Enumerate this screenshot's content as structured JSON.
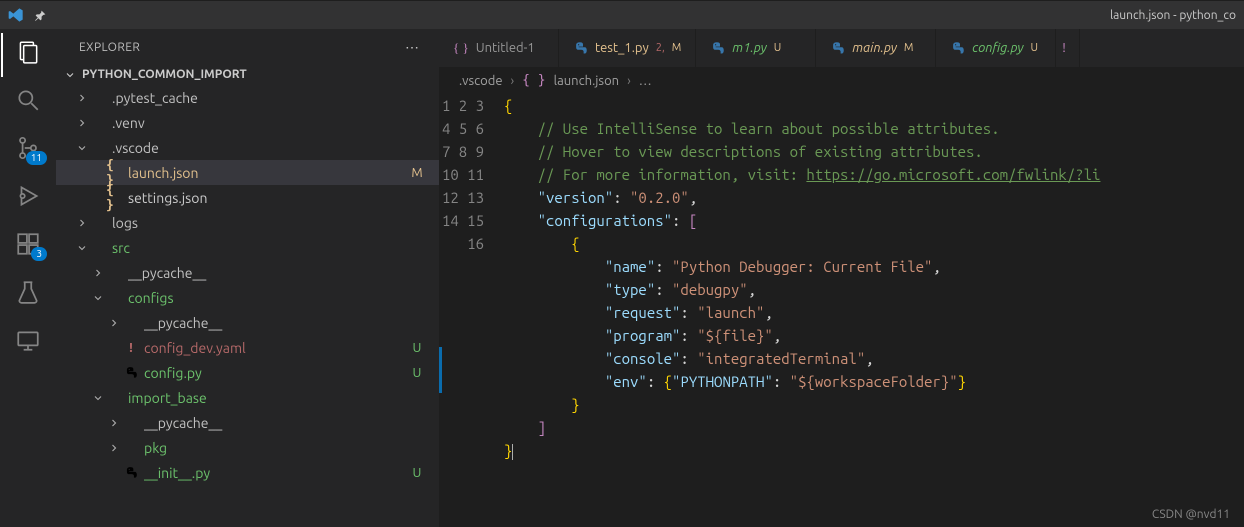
{
  "window": {
    "title": "launch.json - python_co"
  },
  "activity": {
    "badges": {
      "scm": "11",
      "ext": "3"
    }
  },
  "sidebar": {
    "title": "EXPLORER",
    "folder": "PYTHON_COMMON_IMPORT",
    "tree": [
      {
        "name": ".pytest_cache",
        "kind": "folder",
        "depth": 0,
        "chev": "right"
      },
      {
        "name": ".venv",
        "kind": "folder",
        "depth": 0,
        "chev": "right"
      },
      {
        "name": ".vscode",
        "kind": "folder",
        "depth": 0,
        "chev": "down",
        "dot": "gray"
      },
      {
        "name": "launch.json",
        "kind": "json",
        "depth": 1,
        "status": "M",
        "class": "modified active",
        "braceColor": "Y"
      },
      {
        "name": "settings.json",
        "kind": "json",
        "depth": 1,
        "braceColor": "Y"
      },
      {
        "name": "logs",
        "kind": "folder",
        "depth": 0,
        "chev": "right"
      },
      {
        "name": "src",
        "kind": "folder",
        "depth": 0,
        "chev": "down",
        "class": "untracked",
        "dot": "green"
      },
      {
        "name": "__pycache__",
        "kind": "folder",
        "depth": 1,
        "chev": "right"
      },
      {
        "name": "configs",
        "kind": "folder",
        "depth": 1,
        "chev": "down",
        "class": "untracked",
        "dot": "green"
      },
      {
        "name": "__pycache__",
        "kind": "folder",
        "depth": 2,
        "chev": "right"
      },
      {
        "name": "config_dev.yaml",
        "kind": "yaml",
        "depth": 2,
        "status": "U",
        "class": "untracked errfile"
      },
      {
        "name": "config.py",
        "kind": "py",
        "depth": 2,
        "status": "U",
        "class": "untracked"
      },
      {
        "name": "import_base",
        "kind": "folder",
        "depth": 1,
        "chev": "down",
        "class": "untracked",
        "dot": "green"
      },
      {
        "name": "__pycache__",
        "kind": "folder",
        "depth": 2,
        "chev": "right"
      },
      {
        "name": "pkg",
        "kind": "folder",
        "depth": 2,
        "chev": "right",
        "class": "untracked",
        "dot": "green"
      },
      {
        "name": "__init__.py",
        "kind": "py",
        "depth": 2,
        "status": "U",
        "class": "untracked"
      }
    ]
  },
  "tabs": [
    {
      "icon": "brace",
      "label": "Untitled-1"
    },
    {
      "icon": "py",
      "label": "test_1.py",
      "s1": "2,",
      "s2": "M",
      "class": "mod"
    },
    {
      "icon": "py",
      "label": "m1.py",
      "s2": "U",
      "class": "unt italic"
    },
    {
      "icon": "py",
      "label": "main.py",
      "s2": "M",
      "class": "mod italic"
    },
    {
      "icon": "py",
      "label": "config.py",
      "s2": "U",
      "class": "unt italic"
    }
  ],
  "tab_end_glyph": "!",
  "breadcrumb": {
    "a": ".vscode",
    "b": "launch.json",
    "end": "…",
    "brace": "{ }"
  },
  "editor": {
    "lines": 16,
    "code": [
      "<span class='y'>{</span>",
      "    <span class='c'>// Use IntelliSense to learn about possible attributes.</span>",
      "    <span class='c'>// Hover to view descriptions of existing attributes.</span>",
      "    <span class='c'>// For more information, visit: </span><span class='link'>https://go.microsoft.com/fwlink/?li</span>",
      "    <span class='k'>\"version\"</span><span class='p'>: </span><span class='s'>\"0.2.0\"</span><span class='p'>,</span>",
      "    <span class='k'>\"configurations\"</span><span class='p'>: </span><span class='m'>[</span>",
      "        <span class='y'>{</span>",
      "            <span class='k'>\"name\"</span><span class='p'>: </span><span class='s'>\"Python Debugger: Current File\"</span><span class='p'>,</span>",
      "            <span class='k'>\"type\"</span><span class='p'>: </span><span class='s'>\"debugpy\"</span><span class='p'>,</span>",
      "            <span class='k'>\"request\"</span><span class='p'>: </span><span class='s'>\"launch\"</span><span class='p'>,</span>",
      "            <span class='k'>\"program\"</span><span class='p'>: </span><span class='s'>\"${file}\"</span><span class='p'>,</span>",
      "            <span class='k'>\"console\"</span><span class='p'>: </span><span class='s'>\"integratedTerminal\"</span><span class='p'>,</span>",
      "            <span class='k'>\"env\"</span><span class='p'>: </span><span class='y'>{</span><span class='k'>\"PYTHONPATH\"</span><span class='p'>: </span><span class='s'>\"${workspaceFolder}\"</span><span class='y'>}</span>",
      "        <span class='y'>}</span>",
      "    <span class='m'>]</span>",
      "<span class='y'>}</span><span class='cursor'></span>"
    ]
  },
  "watermark": "CSDN @nvd11"
}
